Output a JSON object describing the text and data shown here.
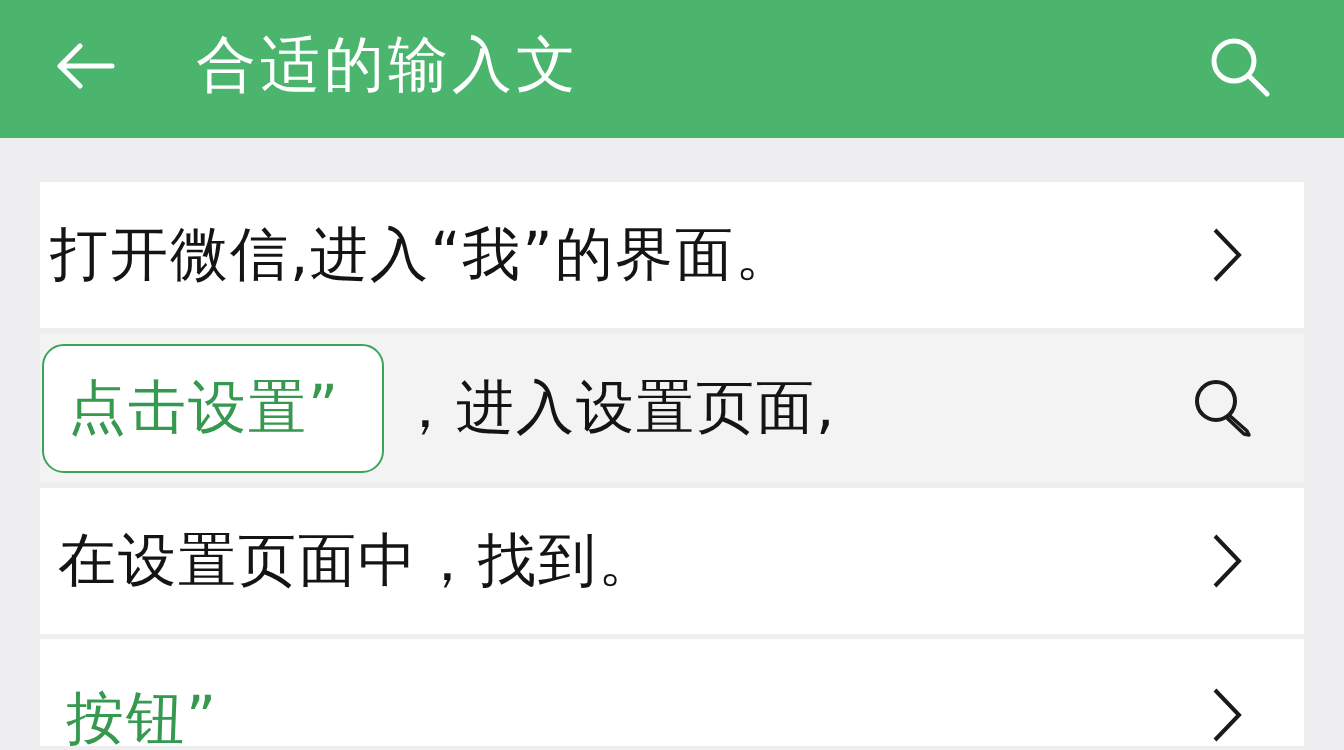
{
  "header": {
    "title": "合适的输入文"
  },
  "rows": [
    {
      "kind": "plain",
      "text": "打开微信,进入“我”的界面。",
      "selected": false
    },
    {
      "kind": "chip",
      "chip": "点击设置”",
      "text": "，进入设置页面,",
      "selected": true
    },
    {
      "kind": "plain",
      "text": "在设置页面中，找到。",
      "selected": false
    },
    {
      "kind": "accent",
      "text": "按钮”",
      "selected": false
    }
  ]
}
